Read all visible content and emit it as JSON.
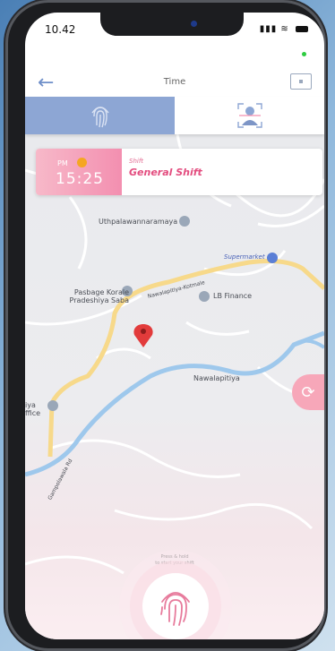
{
  "status": {
    "time": "10.42"
  },
  "header": {
    "title": "Time"
  },
  "shift": {
    "ampm": "PM",
    "time": "15:25",
    "caption": "Shift",
    "name": "General Shift"
  },
  "map": {
    "labels": {
      "temple": "Uthpalawannaramaya",
      "supermarket": "Supermarket",
      "pradeshiya": "Pasbage Korale\nPradeshiya Saba",
      "road": "Nawalapitiya-Kotmale",
      "finance": "LB Finance",
      "town": "Nawalapitiya",
      "office": "iya\nffice",
      "road2": "Gampolawala Rd"
    }
  },
  "action": {
    "hint_line1": "Press & hold",
    "hint_line2": "to start your shift"
  },
  "colors": {
    "accent": "#8da6d4",
    "pink": "#f38fb0",
    "river": "#9ec8ec",
    "road": "#f7d98a",
    "pin": "#e23b3b"
  },
  "icons": {
    "back": "arrow-left-icon",
    "calendar": "calendar-icon",
    "fingerprint": "fingerprint-icon",
    "face": "face-scan-icon",
    "refresh": "refresh-icon",
    "pin": "map-pin-icon"
  }
}
